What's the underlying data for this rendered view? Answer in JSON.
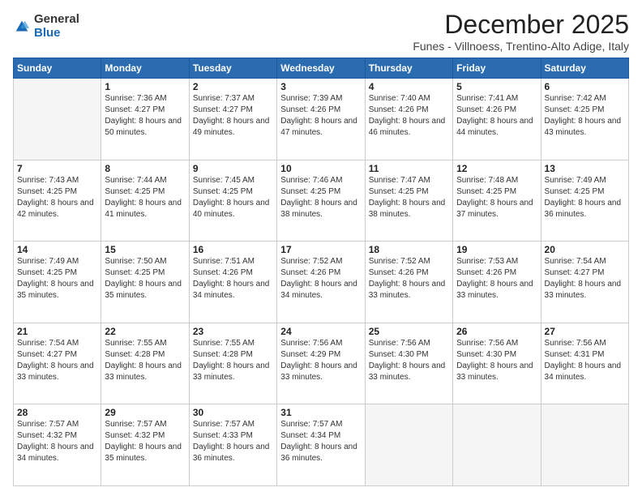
{
  "logo": {
    "general": "General",
    "blue": "Blue"
  },
  "header": {
    "month": "December 2025",
    "location": "Funes - Villnoess, Trentino-Alto Adige, Italy"
  },
  "days_of_week": [
    "Sunday",
    "Monday",
    "Tuesday",
    "Wednesday",
    "Thursday",
    "Friday",
    "Saturday"
  ],
  "weeks": [
    [
      {
        "day": "",
        "empty": true
      },
      {
        "day": "1",
        "sunrise": "7:36 AM",
        "sunset": "4:27 PM",
        "daylight": "8 hours and 50 minutes."
      },
      {
        "day": "2",
        "sunrise": "7:37 AM",
        "sunset": "4:27 PM",
        "daylight": "8 hours and 49 minutes."
      },
      {
        "day": "3",
        "sunrise": "7:39 AM",
        "sunset": "4:26 PM",
        "daylight": "8 hours and 47 minutes."
      },
      {
        "day": "4",
        "sunrise": "7:40 AM",
        "sunset": "4:26 PM",
        "daylight": "8 hours and 46 minutes."
      },
      {
        "day": "5",
        "sunrise": "7:41 AM",
        "sunset": "4:26 PM",
        "daylight": "8 hours and 44 minutes."
      },
      {
        "day": "6",
        "sunrise": "7:42 AM",
        "sunset": "4:25 PM",
        "daylight": "8 hours and 43 minutes."
      }
    ],
    [
      {
        "day": "7",
        "sunrise": "7:43 AM",
        "sunset": "4:25 PM",
        "daylight": "8 hours and 42 minutes."
      },
      {
        "day": "8",
        "sunrise": "7:44 AM",
        "sunset": "4:25 PM",
        "daylight": "8 hours and 41 minutes."
      },
      {
        "day": "9",
        "sunrise": "7:45 AM",
        "sunset": "4:25 PM",
        "daylight": "8 hours and 40 minutes."
      },
      {
        "day": "10",
        "sunrise": "7:46 AM",
        "sunset": "4:25 PM",
        "daylight": "8 hours and 38 minutes."
      },
      {
        "day": "11",
        "sunrise": "7:47 AM",
        "sunset": "4:25 PM",
        "daylight": "8 hours and 38 minutes."
      },
      {
        "day": "12",
        "sunrise": "7:48 AM",
        "sunset": "4:25 PM",
        "daylight": "8 hours and 37 minutes."
      },
      {
        "day": "13",
        "sunrise": "7:49 AM",
        "sunset": "4:25 PM",
        "daylight": "8 hours and 36 minutes."
      }
    ],
    [
      {
        "day": "14",
        "sunrise": "7:49 AM",
        "sunset": "4:25 PM",
        "daylight": "8 hours and 35 minutes."
      },
      {
        "day": "15",
        "sunrise": "7:50 AM",
        "sunset": "4:25 PM",
        "daylight": "8 hours and 35 minutes."
      },
      {
        "day": "16",
        "sunrise": "7:51 AM",
        "sunset": "4:26 PM",
        "daylight": "8 hours and 34 minutes."
      },
      {
        "day": "17",
        "sunrise": "7:52 AM",
        "sunset": "4:26 PM",
        "daylight": "8 hours and 34 minutes."
      },
      {
        "day": "18",
        "sunrise": "7:52 AM",
        "sunset": "4:26 PM",
        "daylight": "8 hours and 33 minutes."
      },
      {
        "day": "19",
        "sunrise": "7:53 AM",
        "sunset": "4:26 PM",
        "daylight": "8 hours and 33 minutes."
      },
      {
        "day": "20",
        "sunrise": "7:54 AM",
        "sunset": "4:27 PM",
        "daylight": "8 hours and 33 minutes."
      }
    ],
    [
      {
        "day": "21",
        "sunrise": "7:54 AM",
        "sunset": "4:27 PM",
        "daylight": "8 hours and 33 minutes."
      },
      {
        "day": "22",
        "sunrise": "7:55 AM",
        "sunset": "4:28 PM",
        "daylight": "8 hours and 33 minutes."
      },
      {
        "day": "23",
        "sunrise": "7:55 AM",
        "sunset": "4:28 PM",
        "daylight": "8 hours and 33 minutes."
      },
      {
        "day": "24",
        "sunrise": "7:56 AM",
        "sunset": "4:29 PM",
        "daylight": "8 hours and 33 minutes."
      },
      {
        "day": "25",
        "sunrise": "7:56 AM",
        "sunset": "4:30 PM",
        "daylight": "8 hours and 33 minutes."
      },
      {
        "day": "26",
        "sunrise": "7:56 AM",
        "sunset": "4:30 PM",
        "daylight": "8 hours and 33 minutes."
      },
      {
        "day": "27",
        "sunrise": "7:56 AM",
        "sunset": "4:31 PM",
        "daylight": "8 hours and 34 minutes."
      }
    ],
    [
      {
        "day": "28",
        "sunrise": "7:57 AM",
        "sunset": "4:32 PM",
        "daylight": "8 hours and 34 minutes."
      },
      {
        "day": "29",
        "sunrise": "7:57 AM",
        "sunset": "4:32 PM",
        "daylight": "8 hours and 35 minutes."
      },
      {
        "day": "30",
        "sunrise": "7:57 AM",
        "sunset": "4:33 PM",
        "daylight": "8 hours and 36 minutes."
      },
      {
        "day": "31",
        "sunrise": "7:57 AM",
        "sunset": "4:34 PM",
        "daylight": "8 hours and 36 minutes."
      },
      {
        "day": "",
        "empty": true
      },
      {
        "day": "",
        "empty": true
      },
      {
        "day": "",
        "empty": true
      }
    ]
  ],
  "labels": {
    "sunrise": "Sunrise:",
    "sunset": "Sunset:",
    "daylight": "Daylight:"
  }
}
